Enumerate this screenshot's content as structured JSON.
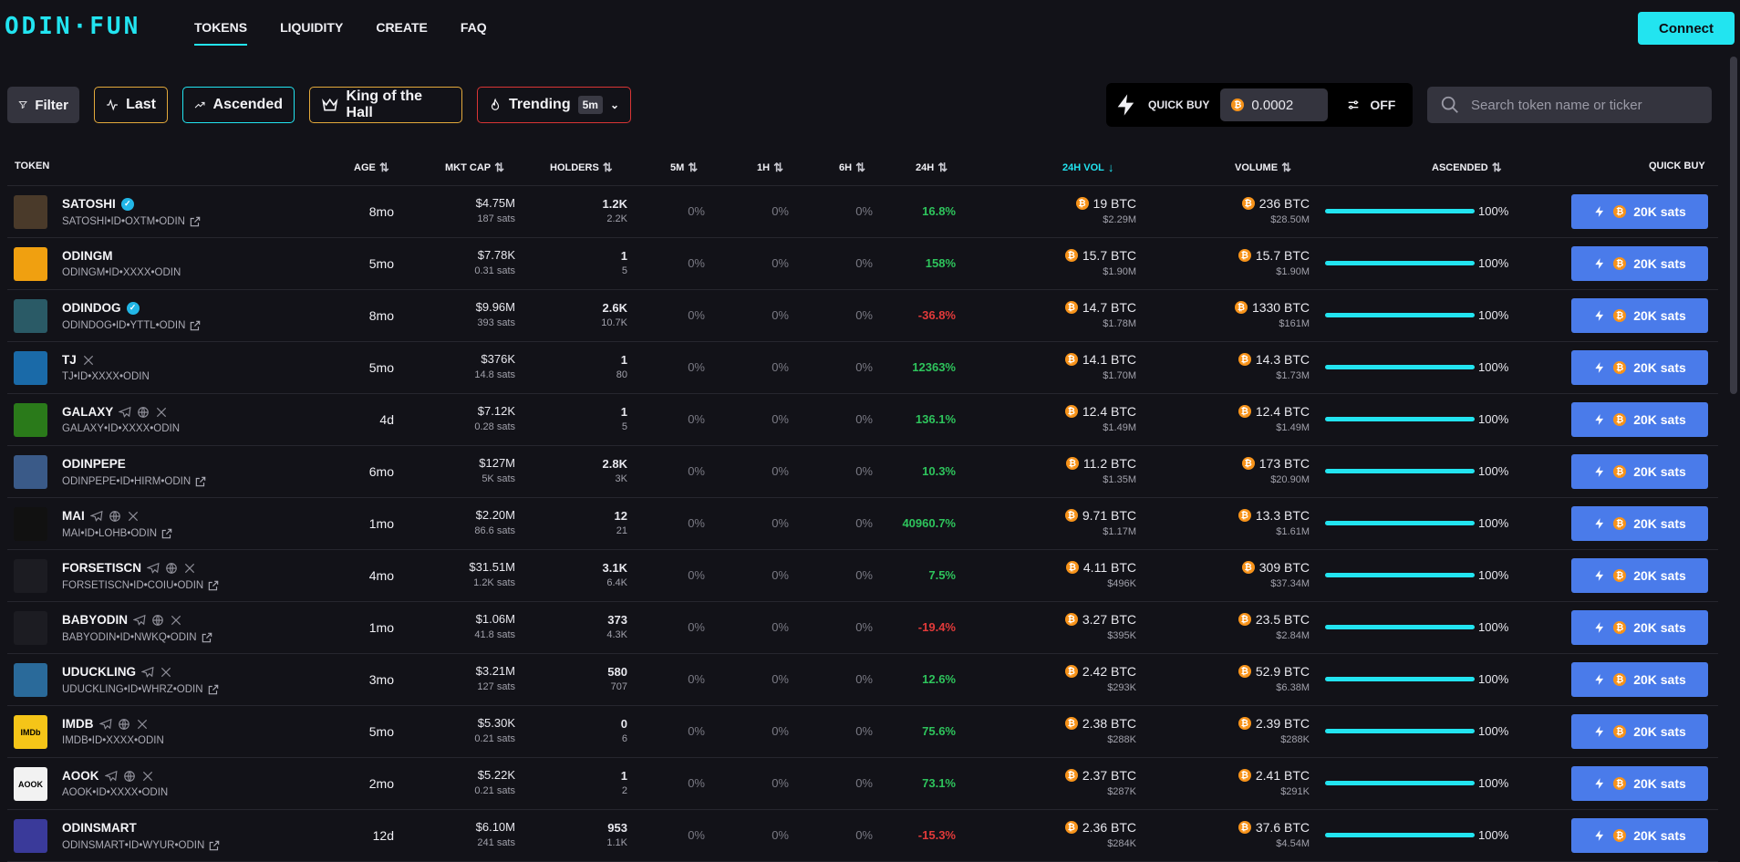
{
  "brand": {
    "logo": "ODIN·FUN",
    "accent": "#22e4f0"
  },
  "nav": [
    "TOKENS",
    "LIQUIDITY",
    "CREATE",
    "FAQ"
  ],
  "connect_label": "Connect",
  "filters": {
    "filter": "Filter",
    "last": "Last",
    "ascended": "Ascended",
    "king": "King of the Hall",
    "trending": "Trending",
    "trending_period": "5m"
  },
  "quick_buy": {
    "label": "QUICK BUY",
    "amount": "0.0002",
    "toggle": "OFF"
  },
  "search": {
    "placeholder": "Search token name or ticker"
  },
  "columns": {
    "token": "TOKEN",
    "age": "AGE",
    "mktcap": "MKT CAP",
    "holders": "HOLDERS",
    "p5m": "5M",
    "p1h": "1H",
    "p6h": "6H",
    "p24h": "24H",
    "vol24h": "24H VOL",
    "volume": "VOLUME",
    "ascended": "ASCENDED",
    "quickbuy": "QUICK BUY"
  },
  "buy_label": "20K sats",
  "rows": [
    {
      "name": "SATOSHI",
      "verified": true,
      "socials": [],
      "id": "SATOSHI•ID•OXTM•ODIN",
      "link": true,
      "age": "8mo",
      "mcap": "$4.75M",
      "price": "187 sats",
      "holders": "1.2K",
      "holders_sub": "2.2K",
      "p5m": "0%",
      "p1h": "0%",
      "p6h": "0%",
      "p24h": "16.8%",
      "p24h_dir": "pos",
      "vol24": "19 BTC",
      "vol24_usd": "$2.29M",
      "vol": "236 BTC",
      "vol_usd": "$28.50M",
      "ascended": "100%",
      "ascended_fraction": 1.0,
      "avatar_color": "#4a3a2a",
      "avatar_icon": "portrait-icon"
    },
    {
      "name": "ODINGM",
      "verified": false,
      "socials": [],
      "id": "ODINGM•ID•XXXX•ODIN",
      "link": false,
      "age": "5mo",
      "mcap": "$7.78K",
      "price": "0.31 sats",
      "holders": "1",
      "holders_sub": "5",
      "p5m": "0%",
      "p1h": "0%",
      "p6h": "0%",
      "p24h": "158%",
      "p24h_dir": "pos",
      "vol24": "15.7 BTC",
      "vol24_usd": "$1.90M",
      "vol": "15.7 BTC",
      "vol_usd": "$1.90M",
      "ascended": "100%",
      "ascended_fraction": 1.0,
      "avatar_color": "#f0a010",
      "avatar_icon": "dog-icon"
    },
    {
      "name": "ODINDOG",
      "verified": true,
      "socials": [],
      "id": "ODINDOG•ID•YTTL•ODIN",
      "link": true,
      "age": "8mo",
      "mcap": "$9.96M",
      "price": "393 sats",
      "holders": "2.6K",
      "holders_sub": "10.7K",
      "p5m": "0%",
      "p1h": "0%",
      "p6h": "0%",
      "p24h": "-36.8%",
      "p24h_dir": "neg",
      "vol24": "14.7 BTC",
      "vol24_usd": "$1.78M",
      "vol": "1330 BTC",
      "vol_usd": "$161M",
      "ascended": "100%",
      "ascended_fraction": 1.0,
      "avatar_color": "#2a5a66",
      "avatar_icon": "wolf-icon"
    },
    {
      "name": "TJ",
      "verified": false,
      "socials": [
        "x"
      ],
      "id": "TJ•ID•XXXX•ODIN",
      "link": false,
      "age": "5mo",
      "mcap": "$376K",
      "price": "14.8 sats",
      "holders": "1",
      "holders_sub": "80",
      "p5m": "0%",
      "p1h": "0%",
      "p6h": "0%",
      "p24h": "12363%",
      "p24h_dir": "pos",
      "vol24": "14.1 BTC",
      "vol24_usd": "$1.70M",
      "vol": "14.3 BTC",
      "vol_usd": "$1.73M",
      "ascended": "100%",
      "ascended_fraction": 1.0,
      "avatar_color": "#1a6aa8",
      "avatar_icon": "creature-icon"
    },
    {
      "name": "GALAXY",
      "verified": false,
      "socials": [
        "telegram",
        "web",
        "x"
      ],
      "id": "GALAXY•ID•XXXX•ODIN",
      "link": false,
      "age": "4d",
      "mcap": "$7.12K",
      "price": "0.28 sats",
      "holders": "1",
      "holders_sub": "5",
      "p5m": "0%",
      "p1h": "0%",
      "p6h": "0%",
      "p24h": "136.1%",
      "p24h_dir": "pos",
      "vol24": "12.4 BTC",
      "vol24_usd": "$1.49M",
      "vol": "12.4 BTC",
      "vol_usd": "$1.49M",
      "ascended": "100%",
      "ascended_fraction": 1.0,
      "avatar_color": "#2a7a1a",
      "avatar_icon": "galaxy-icon"
    },
    {
      "name": "ODINPEPE",
      "verified": false,
      "socials": [],
      "id": "ODINPEPE•ID•HIRM•ODIN",
      "link": true,
      "age": "6mo",
      "mcap": "$127M",
      "price": "5K sats",
      "holders": "2.8K",
      "holders_sub": "3K",
      "p5m": "0%",
      "p1h": "0%",
      "p6h": "0%",
      "p24h": "10.3%",
      "p24h_dir": "pos",
      "vol24": "11.2 BTC",
      "vol24_usd": "$1.35M",
      "vol": "173 BTC",
      "vol_usd": "$20.90M",
      "ascended": "100%",
      "ascended_fraction": 1.0,
      "avatar_color": "#3a5a88",
      "avatar_icon": "frog-icon"
    },
    {
      "name": "MAI",
      "verified": false,
      "socials": [
        "telegram",
        "web",
        "x"
      ],
      "id": "MAI•ID•LOHB•ODIN",
      "link": true,
      "age": "1mo",
      "mcap": "$2.20M",
      "price": "86.6 sats",
      "holders": "12",
      "holders_sub": "21",
      "p5m": "0%",
      "p1h": "0%",
      "p6h": "0%",
      "p24h": "40960.7%",
      "p24h_dir": "pos",
      "vol24": "9.71 BTC",
      "vol24_usd": "$1.17M",
      "vol": "13.3 BTC",
      "vol_usd": "$1.61M",
      "ascended": "100%",
      "ascended_fraction": 1.0,
      "avatar_color": "#111111",
      "avatar_icon": "ai-cube-icon"
    },
    {
      "name": "FORSETISCN",
      "verified": false,
      "socials": [
        "telegram",
        "web",
        "x"
      ],
      "id": "FORSETISCN•ID•COIU•ODIN",
      "link": true,
      "age": "4mo",
      "mcap": "$31.51M",
      "price": "1.2K sats",
      "holders": "3.1K",
      "holders_sub": "6.4K",
      "p5m": "0%",
      "p1h": "0%",
      "p6h": "0%",
      "p24h": "7.5%",
      "p24h_dir": "pos",
      "vol24": "4.11 BTC",
      "vol24_usd": "$496K",
      "vol": "309 BTC",
      "vol_usd": "$37.34M",
      "ascended": "100%",
      "ascended_fraction": 1.0,
      "avatar_color": "#1c1c22",
      "avatar_icon": "scales-icon"
    },
    {
      "name": "BABYODIN",
      "verified": false,
      "socials": [
        "telegram",
        "web",
        "x"
      ],
      "id": "BABYODIN•ID•NWKQ•ODIN",
      "link": true,
      "age": "1mo",
      "mcap": "$1.06M",
      "price": "41.8 sats",
      "holders": "373",
      "holders_sub": "4.3K",
      "p5m": "0%",
      "p1h": "0%",
      "p6h": "0%",
      "p24h": "-19.4%",
      "p24h_dir": "neg",
      "vol24": "3.27 BTC",
      "vol24_usd": "$395K",
      "vol": "23.5 BTC",
      "vol_usd": "$2.84M",
      "ascended": "100%",
      "ascended_fraction": 1.0,
      "avatar_color": "#1c1c22",
      "avatar_icon": "viking-icon"
    },
    {
      "name": "UDUCKLING",
      "verified": false,
      "socials": [
        "telegram",
        "x"
      ],
      "id": "UDUCKLING•ID•WHRZ•ODIN",
      "link": true,
      "age": "3mo",
      "mcap": "$3.21M",
      "price": "127 sats",
      "holders": "580",
      "holders_sub": "707",
      "p5m": "0%",
      "p1h": "0%",
      "p6h": "0%",
      "p24h": "12.6%",
      "p24h_dir": "pos",
      "vol24": "2.42 BTC",
      "vol24_usd": "$293K",
      "vol": "52.9 BTC",
      "vol_usd": "$6.38M",
      "ascended": "100%",
      "ascended_fraction": 1.0,
      "avatar_color": "#2a6a9a",
      "avatar_icon": "duck-icon"
    },
    {
      "name": "IMDB",
      "verified": false,
      "socials": [
        "telegram",
        "web",
        "x"
      ],
      "id": "IMDB•ID•XXXX•ODIN",
      "link": false,
      "age": "5mo",
      "mcap": "$5.30K",
      "price": "0.21 sats",
      "holders": "0",
      "holders_sub": "6",
      "p5m": "0%",
      "p1h": "0%",
      "p6h": "0%",
      "p24h": "75.6%",
      "p24h_dir": "pos",
      "vol24": "2.38 BTC",
      "vol24_usd": "$288K",
      "vol": "2.39 BTC",
      "vol_usd": "$288K",
      "ascended": "100%",
      "ascended_fraction": 1.0,
      "avatar_color": "#f5c518",
      "avatar_icon": "imdb-logo-icon",
      "avatar_text": "IMDb"
    },
    {
      "name": "AOOK",
      "verified": false,
      "socials": [
        "telegram",
        "web",
        "x"
      ],
      "id": "AOOK•ID•XXXX•ODIN",
      "link": false,
      "age": "2mo",
      "mcap": "$5.22K",
      "price": "0.21 sats",
      "holders": "1",
      "holders_sub": "2",
      "p5m": "0%",
      "p1h": "0%",
      "p6h": "0%",
      "p24h": "73.1%",
      "p24h_dir": "pos",
      "vol24": "2.37 BTC",
      "vol24_usd": "$287K",
      "vol": "2.41 BTC",
      "vol_usd": "$291K",
      "ascended": "100%",
      "ascended_fraction": 1.0,
      "avatar_color": "#f2f2f2",
      "avatar_icon": "aook-logo-icon",
      "avatar_text": "AOOK"
    },
    {
      "name": "ODINSMART",
      "verified": false,
      "socials": [],
      "id": "ODINSMART•ID•WYUR•ODIN",
      "link": true,
      "age": "12d",
      "mcap": "$6.10M",
      "price": "241 sats",
      "holders": "953",
      "holders_sub": "1.1K",
      "p5m": "0%",
      "p1h": "0%",
      "p6h": "0%",
      "p24h": "-15.3%",
      "p24h_dir": "neg",
      "vol24": "2.36 BTC",
      "vol24_usd": "$284K",
      "vol": "37.6 BTC",
      "vol_usd": "$4.54M",
      "ascended": "100%",
      "ascended_fraction": 1.0,
      "avatar_color": "#3a3a9a",
      "avatar_icon": "mandala-icon"
    }
  ]
}
